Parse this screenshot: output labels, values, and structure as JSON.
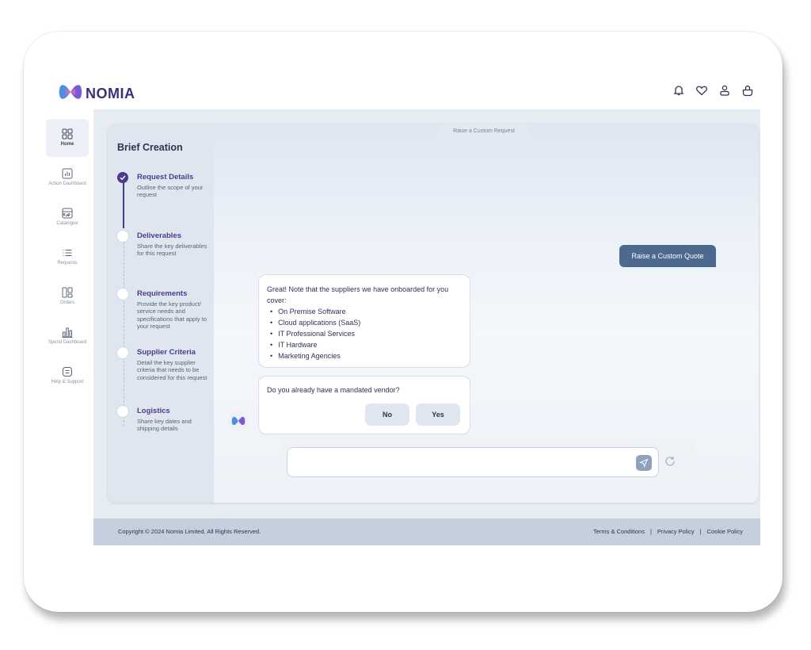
{
  "brand": {
    "name": "NOMIA",
    "accent": "#4b3b8c"
  },
  "top_icons": [
    "bell-icon",
    "heart-icon",
    "user-icon",
    "bag-icon"
  ],
  "sidebar": {
    "items": [
      {
        "label": "Home",
        "icon": "grid-icon",
        "active": true
      },
      {
        "label": "Action Dashboard",
        "icon": "chart-icon",
        "active": false
      },
      {
        "label": "Catalogue",
        "icon": "catalogue-icon",
        "active": false
      },
      {
        "label": "Requests",
        "icon": "list-icon",
        "active": false
      },
      {
        "label": "Orders",
        "icon": "orders-icon",
        "active": false
      },
      {
        "label": "Spend Dashboard",
        "icon": "bar-chart-icon",
        "active": false
      },
      {
        "label": "Help & Support",
        "icon": "help-icon",
        "active": false
      }
    ]
  },
  "brief": {
    "title": "Brief Creation",
    "steps": [
      {
        "title": "Request Details",
        "desc": "Outline the scope of your request",
        "done": true
      },
      {
        "title": "Deliverables",
        "desc": "Share the key deliverables for this request",
        "done": false
      },
      {
        "title": "Requirements",
        "desc": "Provide the key product/ service needs and specifications that apply to your request",
        "done": false
      },
      {
        "title": "Supplier Criteria",
        "desc": "Detail the key supplier criteria that needs to be considered for this request",
        "done": false
      },
      {
        "title": "Logistics",
        "desc": "Share key dates and shipping details",
        "done": false
      }
    ]
  },
  "chat": {
    "header": "Raise a Custom Request",
    "quote_button": "Raise a Custom Quote",
    "message1_intro": "Great! Note that the suppliers we have onboarded for you cover:",
    "message1_items": [
      "On Premise Software",
      "Cloud applications (SaaS)",
      "IT Professional Services",
      "IT Hardware",
      "Marketing Agencies"
    ],
    "message2": "Do you already have a mandated vendor?",
    "no_label": "No",
    "yes_label": "Yes",
    "input_placeholder": ""
  },
  "footer": {
    "copyright": "Copyright © 2024 Nomia Limited. All Rights Reserved.",
    "terms": "Terms & Conditions",
    "privacy": "Privacy Policy",
    "cookie": "Cookie Policy",
    "separator": "|"
  }
}
